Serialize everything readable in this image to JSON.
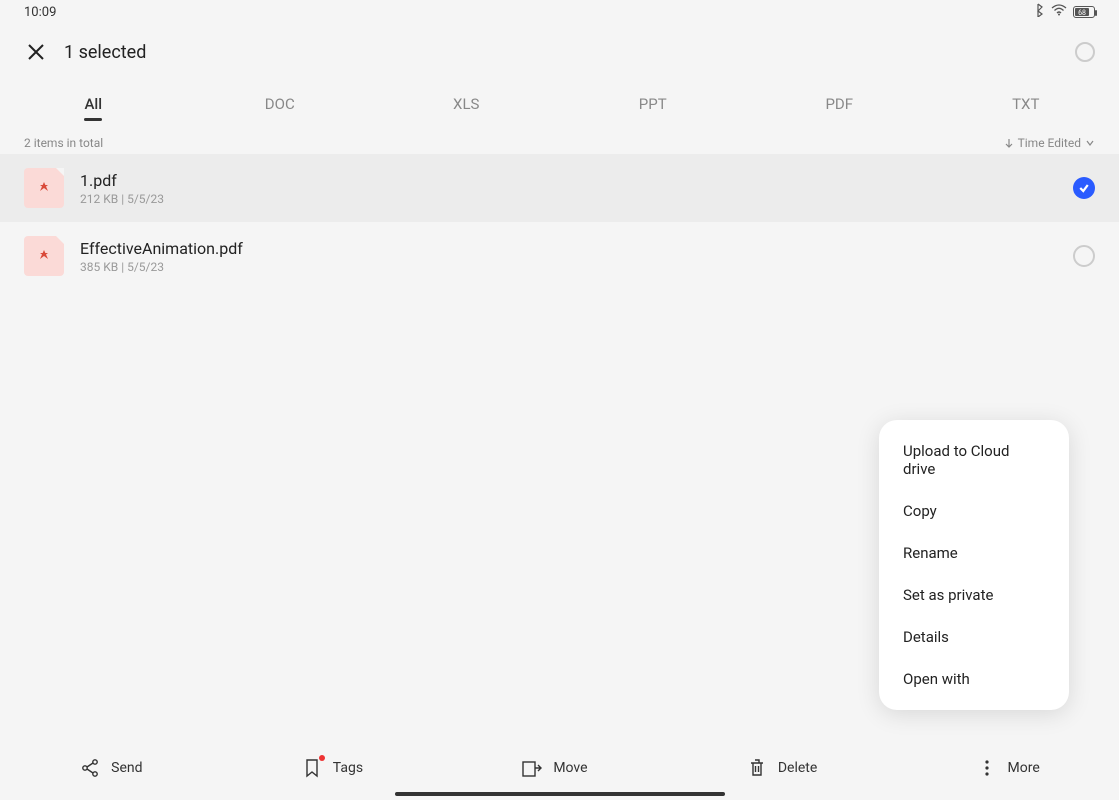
{
  "status": {
    "time": "10:09",
    "battery": "68"
  },
  "header": {
    "title": "1 selected"
  },
  "tabs": [
    "All",
    "DOC",
    "XLS",
    "PPT",
    "PDF",
    "TXT"
  ],
  "active_tab_index": 0,
  "summary": {
    "count": "2 items in total",
    "sort": "Time Edited"
  },
  "files": [
    {
      "name": "1.pdf",
      "size": "212 KB",
      "date": "5/5/23",
      "selected": true
    },
    {
      "name": "EffectiveAnimation.pdf",
      "size": "385 KB",
      "date": "5/5/23",
      "selected": false
    }
  ],
  "context_menu": [
    "Upload to Cloud drive",
    "Copy",
    "Rename",
    "Set as private",
    "Details",
    "Open with"
  ],
  "actions": {
    "send": "Send",
    "tags": "Tags",
    "move": "Move",
    "delete": "Delete",
    "more": "More"
  }
}
